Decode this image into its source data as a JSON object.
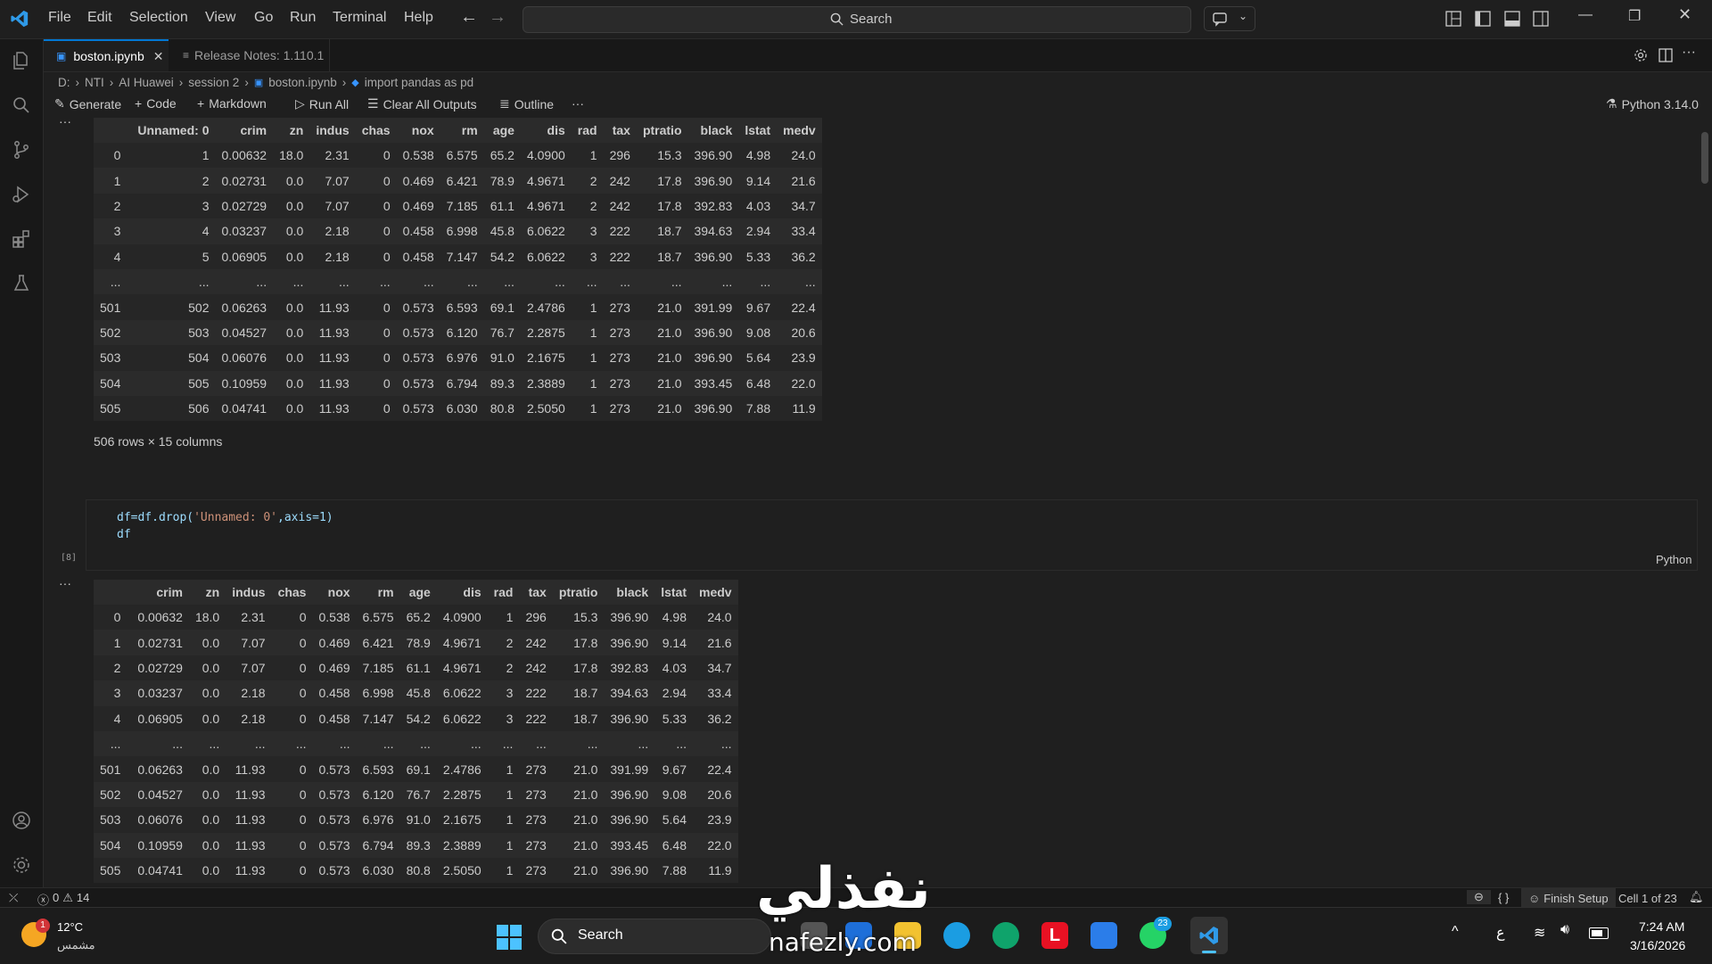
{
  "menu": [
    "File",
    "Edit",
    "Selection",
    "View",
    "Go",
    "Run",
    "Terminal",
    "Help"
  ],
  "search": {
    "label": "Search"
  },
  "tabs": [
    {
      "label": "boston.ipynb",
      "active": true
    },
    {
      "label": "Release Notes: 1.110.1",
      "active": false
    }
  ],
  "breadcrumb": [
    "D:",
    "NTI",
    "AI Huawei",
    "session 2",
    "boston.ipynb",
    "import pandas as pd"
  ],
  "toolbar": {
    "generate": "Generate",
    "code": "Code",
    "markdown": "Markdown",
    "run_all": "Run All",
    "clear_outputs": "Clear All Outputs",
    "outline": "Outline",
    "more": "···",
    "kernel": "Python 3.14.0"
  },
  "table1": {
    "headers": [
      "",
      "Unnamed: 0",
      "crim",
      "zn",
      "indus",
      "chas",
      "nox",
      "rm",
      "age",
      "dis",
      "rad",
      "tax",
      "ptratio",
      "black",
      "lstat",
      "medv"
    ],
    "rows": [
      [
        "0",
        "1",
        "0.00632",
        "18.0",
        "2.31",
        "0",
        "0.538",
        "6.575",
        "65.2",
        "4.0900",
        "1",
        "296",
        "15.3",
        "396.90",
        "4.98",
        "24.0"
      ],
      [
        "1",
        "2",
        "0.02731",
        "0.0",
        "7.07",
        "0",
        "0.469",
        "6.421",
        "78.9",
        "4.9671",
        "2",
        "242",
        "17.8",
        "396.90",
        "9.14",
        "21.6"
      ],
      [
        "2",
        "3",
        "0.02729",
        "0.0",
        "7.07",
        "0",
        "0.469",
        "7.185",
        "61.1",
        "4.9671",
        "2",
        "242",
        "17.8",
        "392.83",
        "4.03",
        "34.7"
      ],
      [
        "3",
        "4",
        "0.03237",
        "0.0",
        "2.18",
        "0",
        "0.458",
        "6.998",
        "45.8",
        "6.0622",
        "3",
        "222",
        "18.7",
        "394.63",
        "2.94",
        "33.4"
      ],
      [
        "4",
        "5",
        "0.06905",
        "0.0",
        "2.18",
        "0",
        "0.458",
        "7.147",
        "54.2",
        "6.0622",
        "3",
        "222",
        "18.7",
        "396.90",
        "5.33",
        "36.2"
      ],
      [
        "...",
        "...",
        "...",
        "...",
        "...",
        "...",
        "...",
        "...",
        "...",
        "...",
        "...",
        "...",
        "...",
        "...",
        "...",
        "..."
      ],
      [
        "501",
        "502",
        "0.06263",
        "0.0",
        "11.93",
        "0",
        "0.573",
        "6.593",
        "69.1",
        "2.4786",
        "1",
        "273",
        "21.0",
        "391.99",
        "9.67",
        "22.4"
      ],
      [
        "502",
        "503",
        "0.04527",
        "0.0",
        "11.93",
        "0",
        "0.573",
        "6.120",
        "76.7",
        "2.2875",
        "1",
        "273",
        "21.0",
        "396.90",
        "9.08",
        "20.6"
      ],
      [
        "503",
        "504",
        "0.06076",
        "0.0",
        "11.93",
        "0",
        "0.573",
        "6.976",
        "91.0",
        "2.1675",
        "1",
        "273",
        "21.0",
        "396.90",
        "5.64",
        "23.9"
      ],
      [
        "504",
        "505",
        "0.10959",
        "0.0",
        "11.93",
        "0",
        "0.573",
        "6.794",
        "89.3",
        "2.3889",
        "1",
        "273",
        "21.0",
        "393.45",
        "6.48",
        "22.0"
      ],
      [
        "505",
        "506",
        "0.04741",
        "0.0",
        "11.93",
        "0",
        "0.573",
        "6.030",
        "80.8",
        "2.5050",
        "1",
        "273",
        "21.0",
        "396.90",
        "7.88",
        "11.9"
      ]
    ],
    "rowcount": "506 rows × 15 columns"
  },
  "cell": {
    "exec_count": "[8]",
    "line1_a": "df=df.drop(",
    "line1_str": "'Unnamed: 0'",
    "line1_b": ",axis=1)",
    "line2": "df",
    "language": "Python"
  },
  "table2": {
    "headers": [
      "",
      "crim",
      "zn",
      "indus",
      "chas",
      "nox",
      "rm",
      "age",
      "dis",
      "rad",
      "tax",
      "ptratio",
      "black",
      "lstat",
      "medv"
    ],
    "rows": [
      [
        "0",
        "0.00632",
        "18.0",
        "2.31",
        "0",
        "0.538",
        "6.575",
        "65.2",
        "4.0900",
        "1",
        "296",
        "15.3",
        "396.90",
        "4.98",
        "24.0"
      ],
      [
        "1",
        "0.02731",
        "0.0",
        "7.07",
        "0",
        "0.469",
        "6.421",
        "78.9",
        "4.9671",
        "2",
        "242",
        "17.8",
        "396.90",
        "9.14",
        "21.6"
      ],
      [
        "2",
        "0.02729",
        "0.0",
        "7.07",
        "0",
        "0.469",
        "7.185",
        "61.1",
        "4.9671",
        "2",
        "242",
        "17.8",
        "392.83",
        "4.03",
        "34.7"
      ],
      [
        "3",
        "0.03237",
        "0.0",
        "2.18",
        "0",
        "0.458",
        "6.998",
        "45.8",
        "6.0622",
        "3",
        "222",
        "18.7",
        "394.63",
        "2.94",
        "33.4"
      ],
      [
        "4",
        "0.06905",
        "0.0",
        "2.18",
        "0",
        "0.458",
        "7.147",
        "54.2",
        "6.0622",
        "3",
        "222",
        "18.7",
        "396.90",
        "5.33",
        "36.2"
      ],
      [
        "...",
        "...",
        "...",
        "...",
        "...",
        "...",
        "...",
        "...",
        "...",
        "...",
        "...",
        "...",
        "...",
        "...",
        "..."
      ],
      [
        "501",
        "0.06263",
        "0.0",
        "11.93",
        "0",
        "0.573",
        "6.593",
        "69.1",
        "2.4786",
        "1",
        "273",
        "21.0",
        "391.99",
        "9.67",
        "22.4"
      ],
      [
        "502",
        "0.04527",
        "0.0",
        "11.93",
        "0",
        "0.573",
        "6.120",
        "76.7",
        "2.2875",
        "1",
        "273",
        "21.0",
        "396.90",
        "9.08",
        "20.6"
      ],
      [
        "503",
        "0.06076",
        "0.0",
        "11.93",
        "0",
        "0.573",
        "6.976",
        "91.0",
        "2.1675",
        "1",
        "273",
        "21.0",
        "396.90",
        "5.64",
        "23.9"
      ],
      [
        "504",
        "0.10959",
        "0.0",
        "11.93",
        "0",
        "0.573",
        "6.794",
        "89.3",
        "2.3889",
        "1",
        "273",
        "21.0",
        "393.45",
        "6.48",
        "22.0"
      ],
      [
        "505",
        "0.04741",
        "0.0",
        "11.93",
        "0",
        "0.573",
        "6.030",
        "80.8",
        "2.5050",
        "1",
        "273",
        "21.0",
        "396.90",
        "7.88",
        "11.9"
      ]
    ]
  },
  "status": {
    "errors": "0",
    "warnings": "14",
    "finish_setup": "Finish Setup",
    "cell_pos": "Cell 1 of 23"
  },
  "taskbar": {
    "weather_temp": "12°C",
    "weather_desc": "مشمس",
    "weather_badge": "1",
    "search": "Search",
    "whatsapp_badge": "23",
    "lang": "ع",
    "time": "7:24 AM",
    "date": "3/16/2026"
  },
  "watermark": {
    "arabic": "نفذلي",
    "latin": "nafezly.com"
  },
  "colors": {
    "accent": "#0078d4",
    "background": "#1f1f1f",
    "string": "#ce9178",
    "variable": "#9cdcfe"
  }
}
